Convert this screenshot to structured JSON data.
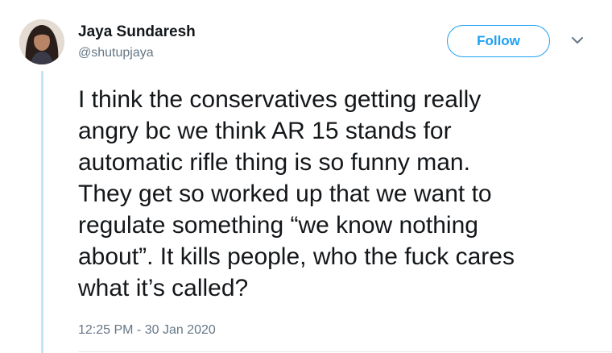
{
  "tweet": {
    "author": {
      "display_name": "Jaya Sundaresh",
      "handle": "@shutupjaya"
    },
    "follow_label": "Follow",
    "text_lines": [
      "I think the conservatives getting really",
      "angry bc we think AR 15 stands for",
      "automatic rifle thing is so funny man.",
      "They get so worked up that we want to",
      "regulate something “we know nothing",
      "about”. It kills people, who the fuck cares",
      "what it’s called?"
    ],
    "timestamp": "12:25 PM - 30 Jan 2020"
  },
  "colors": {
    "accent": "#1da1f2",
    "secondary_text": "#657786",
    "thread_line": "#c4e4f7"
  },
  "icons": {
    "menu": "chevron-down-icon"
  }
}
